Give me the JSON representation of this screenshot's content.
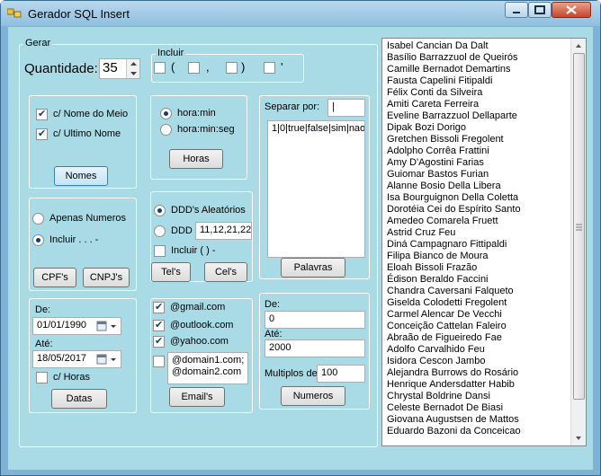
{
  "window": {
    "title": "Gerador SQL Insert"
  },
  "group_gerar": {
    "label": "Gerar"
  },
  "quantidade": {
    "label": "Quantidade:",
    "value": "35"
  },
  "incluir": {
    "label": "Incluir",
    "opt1": "(",
    "opt2": ",",
    "opt3": ")",
    "opt4": "'"
  },
  "nomes": {
    "meio_label": "c/ Nome do Meio",
    "ultimo_label": "c/ Ultimo Nome",
    "button": "Nomes"
  },
  "horas": {
    "opt1": "hora:min",
    "opt2": "hora:min:seg",
    "button": "Horas"
  },
  "palavras": {
    "separar_label": "Separar por:",
    "separar_value": "|",
    "text_value": "1|0|true|false|sim|nao",
    "button": "Palavras"
  },
  "docs": {
    "opt1": "Apenas Numeros",
    "opt2": "Incluir . . . -",
    "cpf_button": "CPF's",
    "cnpj_button": "CNPJ's"
  },
  "telefones": {
    "opt1": "DDD's Aleatórios",
    "opt2": "DDD",
    "ddd_value": "11,12,21,22",
    "incluir_label": "Incluir ( ) -",
    "tel_button": "Tel's",
    "cel_button": "Cel's"
  },
  "datas": {
    "de_label": "De:",
    "de_value": "01/01/1990",
    "ate_label": "Até:",
    "ate_value": "18/05/2017",
    "horas_label": "c/ Horas",
    "button": "Datas"
  },
  "emails": {
    "opt1": "@gmail.com",
    "opt2": "@outlook.com",
    "opt3": "@yahoo.com",
    "custom_line1": "@domain1.com;",
    "custom_line2": "@domain2.com",
    "button": "Email's"
  },
  "numeros": {
    "de_label": "De:",
    "de_value": "0",
    "ate_label": "Até:",
    "ate_value": "2000",
    "multiplos_label": "Multiplos de",
    "multiplos_value": "100",
    "button": "Numeros"
  },
  "results": [
    "Isabel Cancian Da Dalt",
    "Basílio Barrazzuol de Queirós",
    "Camille Bernadot Demartins",
    "Fausta Capelini Fitipaldi",
    "Félix Conti da Silveira",
    "Amiti Careta Ferreira",
    "Eveline Barrazzuol Dellaparte",
    "Dipak Bozi Dorigo",
    "Gretchen Bissoli Fregolent",
    "Adolpho Corrêa Frattini",
    "Amy D'Agostini Farias",
    "Guiomar Bastos Furian",
    "Alanne Bosio Della Libera",
    "Isa Bourguignon Della Coletta",
    "Dorotéia Cei do Espírito Santo",
    "Amedeo Comarela Fruett",
    "Astrid Cruz Feu",
    "Diná Campagnaro Fittipaldi",
    "Filipa Bianco de Moura",
    "Eloah Bissoli Frazão",
    "Édison Beraldo Faccini",
    "Chandra Caversani Falqueto",
    "Giselda Colodetti Fregolent",
    "Carmel Alencar De Vecchi",
    "Conceição Cattelan Faleiro",
    "Abraão de Figueiredo Fae",
    "Adolfo Carvalhido Feu",
    "Isidora Cescon Jambo",
    "Alejandra Burrows do Rosário",
    "Henrique Andersdatter Habib",
    "Chrystal Boldrine Dansi",
    "Celeste Bernadot De Biasi",
    "Giovana Augustsen de Mattos",
    "Eduardo Bazoni da Conceicao"
  ]
}
